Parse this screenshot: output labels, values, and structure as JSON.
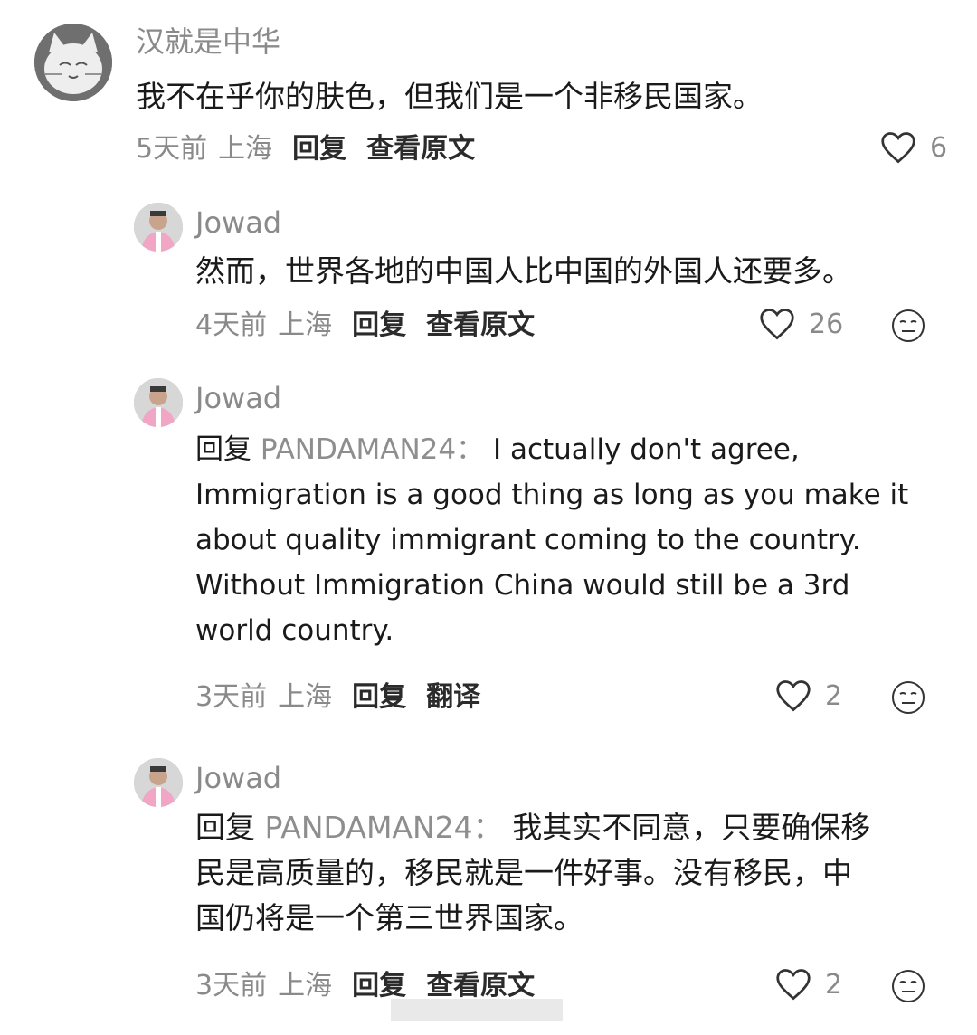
{
  "comments": [
    {
      "author": "汉就是中华",
      "text": "我不在乎你的肤色，但我们是一个非移民国家。",
      "time": "5天前",
      "location": "上海",
      "reply_label": "回复",
      "action_label": "查看原文",
      "likes": "6"
    },
    {
      "author": "Jowad",
      "text": "然而，世界各地的中国人比中国的外国人还要多。",
      "time": "4天前",
      "location": "上海",
      "reply_label": "回复",
      "action_label": "查看原文",
      "likes": "26"
    },
    {
      "author": "Jowad",
      "reply_prefix": "回复",
      "reply_target": "PANDAMAN24：",
      "lines": [
        "I actually don't agree,",
        "Immigration is a good thing as long as you make it",
        "about quality immigrant coming to the country.",
        "Without Immigration China would still be a 3rd",
        "world country."
      ],
      "time": "3天前",
      "location": "上海",
      "reply_label": "回复",
      "action_label": "翻译",
      "likes": "2"
    },
    {
      "author": "Jowad",
      "reply_prefix": "回复",
      "reply_target": "PANDAMAN24：",
      "lines": [
        "我其实不同意，只要确保移",
        "民是高质量的，移民就是一件好事。没有移民，中",
        "国仍将是一个第三世界国家。"
      ],
      "time": "3天前",
      "location": "上海",
      "reply_label": "回复",
      "action_label": "查看原文",
      "likes": "2"
    }
  ],
  "icons": {
    "like": "heart-outline-icon",
    "dislike": "neutral-face-icon"
  },
  "colors": {
    "meta_gray": "#8a8a8a",
    "text": "#1a1a1a"
  }
}
